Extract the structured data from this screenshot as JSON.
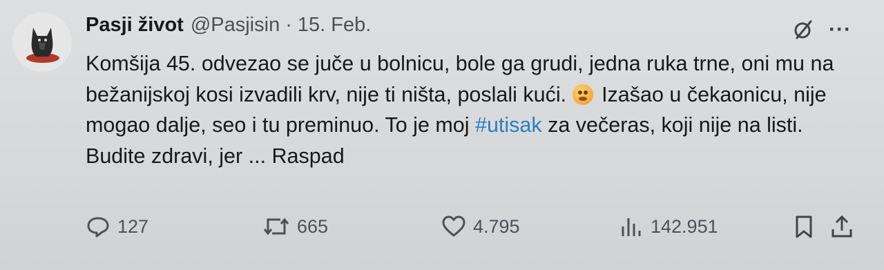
{
  "author": {
    "name": "Pasji život",
    "handle": "@Pasjisin",
    "separator": "·",
    "date": "15. Feb."
  },
  "tweet": {
    "part1": "Komšija 45. odvezao se juče u bolnicu, bole ga grudi, jedna ruka trne, oni mu na bežanijskoj kosi izvadili krv, nije ti ništa, poslali kući. ",
    "emoji": "flushed-face-emoji",
    "part2": " Izašao u čekaonicu, nije mogao dalje, seo i tu preminuo. To je moj ",
    "hashtag": "#utisak",
    "part3": " za večeras, koji nije na listi.",
    "line2": "Budite zdravi, jer ... Raspad"
  },
  "top_actions": {
    "grok_icon": "slashed-circle-icon",
    "more_label": "···"
  },
  "actions": {
    "reply_count": "127",
    "retweet_count": "665",
    "like_count": "4.795",
    "views_count": "142.951"
  },
  "colors": {
    "hashtag": "#2b7fc4",
    "text": "#16181a",
    "muted": "#4b5157"
  }
}
